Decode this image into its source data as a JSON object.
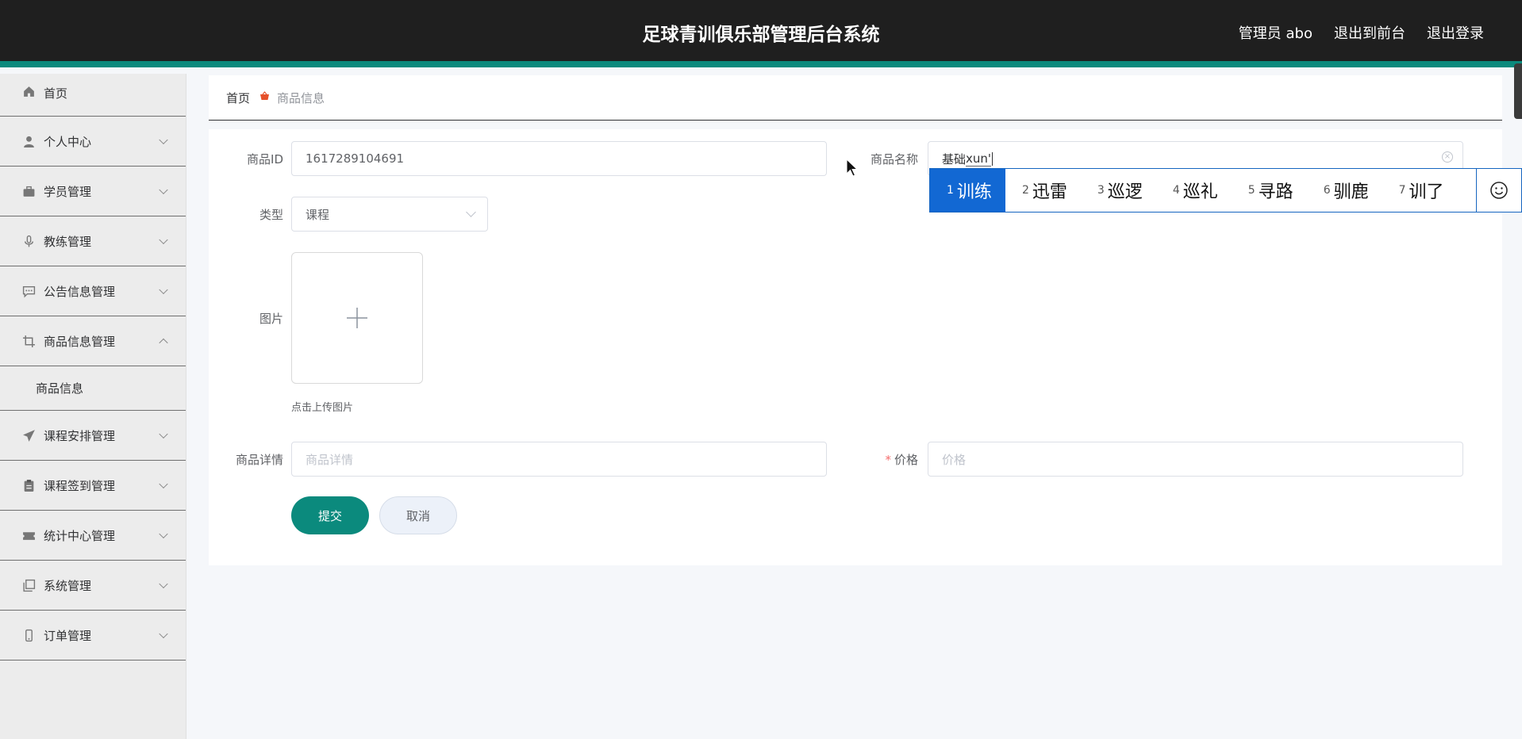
{
  "header": {
    "title": "足球青训俱乐部管理后台系统",
    "admin_label": "管理员 abo",
    "to_frontend": "退出到前台",
    "logout": "退出登录"
  },
  "sidebar": {
    "items": [
      {
        "label": "首页",
        "icon": "home-icon"
      },
      {
        "label": "个人中心",
        "icon": "user-icon"
      },
      {
        "label": "学员管理",
        "icon": "briefcase-icon"
      },
      {
        "label": "教练管理",
        "icon": "microphone-icon"
      },
      {
        "label": "公告信息管理",
        "icon": "chat-icon"
      },
      {
        "label": "商品信息管理",
        "icon": "crop-icon",
        "expanded": true
      },
      {
        "label": "课程安排管理",
        "icon": "send-icon"
      },
      {
        "label": "课程签到管理",
        "icon": "clipboard-icon"
      },
      {
        "label": "统计中心管理",
        "icon": "ticket-icon"
      },
      {
        "label": "系统管理",
        "icon": "copy-icon"
      },
      {
        "label": "订单管理",
        "icon": "phone-icon"
      }
    ],
    "submenu_label": "商品信息"
  },
  "breadcrumb": {
    "home": "首页",
    "current": "商品信息"
  },
  "form": {
    "id_label": "商品ID",
    "id_value": "1617289104691",
    "name_label": "商品名称",
    "name_value": "基础",
    "name_composing": "xun'",
    "type_label": "类型",
    "type_value": "课程",
    "image_label": "图片",
    "upload_tip": "点击上传图片",
    "detail_label": "商品详情",
    "detail_placeholder": "商品详情",
    "price_required_mark": "*",
    "price_label": "价格",
    "price_placeholder": "价格",
    "submit": "提交",
    "cancel": "取消"
  },
  "ime": {
    "candidates": [
      {
        "num": "1",
        "text": "训练"
      },
      {
        "num": "2",
        "text": "迅雷"
      },
      {
        "num": "3",
        "text": "巡逻"
      },
      {
        "num": "4",
        "text": "巡礼"
      },
      {
        "num": "5",
        "text": "寻路"
      },
      {
        "num": "6",
        "text": "驯鹿"
      },
      {
        "num": "7",
        "text": "训了"
      }
    ],
    "selected_index": 0,
    "emoji_icon": "smiley-icon"
  },
  "colors": {
    "accent": "#0b8a7d",
    "header_bg": "#1f1f1f",
    "ime_selected": "#1268d3"
  }
}
